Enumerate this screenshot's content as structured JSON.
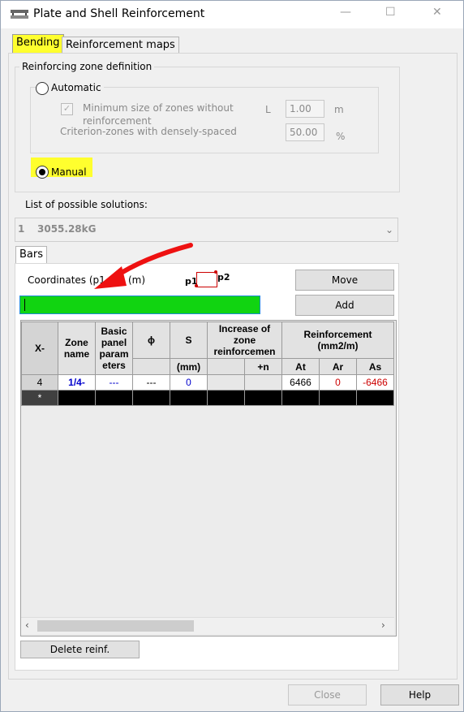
{
  "window": {
    "title": "Plate and Shell Reinforcement",
    "minimize": "—",
    "maximize": "☐",
    "close": "✕"
  },
  "tabs": [
    {
      "label": "Bending"
    },
    {
      "label": "Reinforcement maps"
    }
  ],
  "zone_group": {
    "legend": "Reinforcing zone definition",
    "automatic_label": "Automatic",
    "min_size_label_1": "Minimum size of zones without",
    "min_size_label_2": "reinforcement",
    "l_label": "L",
    "min_size_value": "1.00",
    "min_size_unit": "m",
    "criterion_label": "Criterion-zones with densely-spaced",
    "criterion_value": "50.00",
    "criterion_unit": "%",
    "manual_label": "Manual"
  },
  "solutions": {
    "label": "List of possible solutions:",
    "selected_index": "1",
    "selected_value": "3055.28kG"
  },
  "bars_tab": {
    "label": "Bars"
  },
  "coordinates": {
    "label": "Coordinates (p1",
    "label_end": "(m)",
    "p1": "p1",
    "p2": "p2"
  },
  "buttons": {
    "move": "Move",
    "add": "Add",
    "delete_reinf": "Delete reinf.",
    "close": "Close",
    "help": "Help"
  },
  "table": {
    "headers": {
      "x": "X-",
      "zone_name": "Zone name",
      "basic_panel": "Basic panel param eters",
      "phi": "ϕ",
      "s": "S",
      "increase": "Increase of zone reinforcemen",
      "reinforcement": "Reinforcement (mm2/m)",
      "s_unit": "(mm)",
      "plus_n": "+n",
      "at": "At",
      "ar": "Ar",
      "as": "As"
    },
    "rows": [
      {
        "x": "4",
        "zone": "1/4-",
        "basic": "---",
        "phi": "---",
        "s": "0",
        "inc1": "",
        "inc2": "",
        "at": "6466",
        "ar": "0",
        "as": "-6466"
      }
    ],
    "new_row_marker": "*"
  },
  "colors": {
    "accent_green": "#11d411",
    "highlight": "#ffff2e",
    "arrow": "#ee1111"
  }
}
